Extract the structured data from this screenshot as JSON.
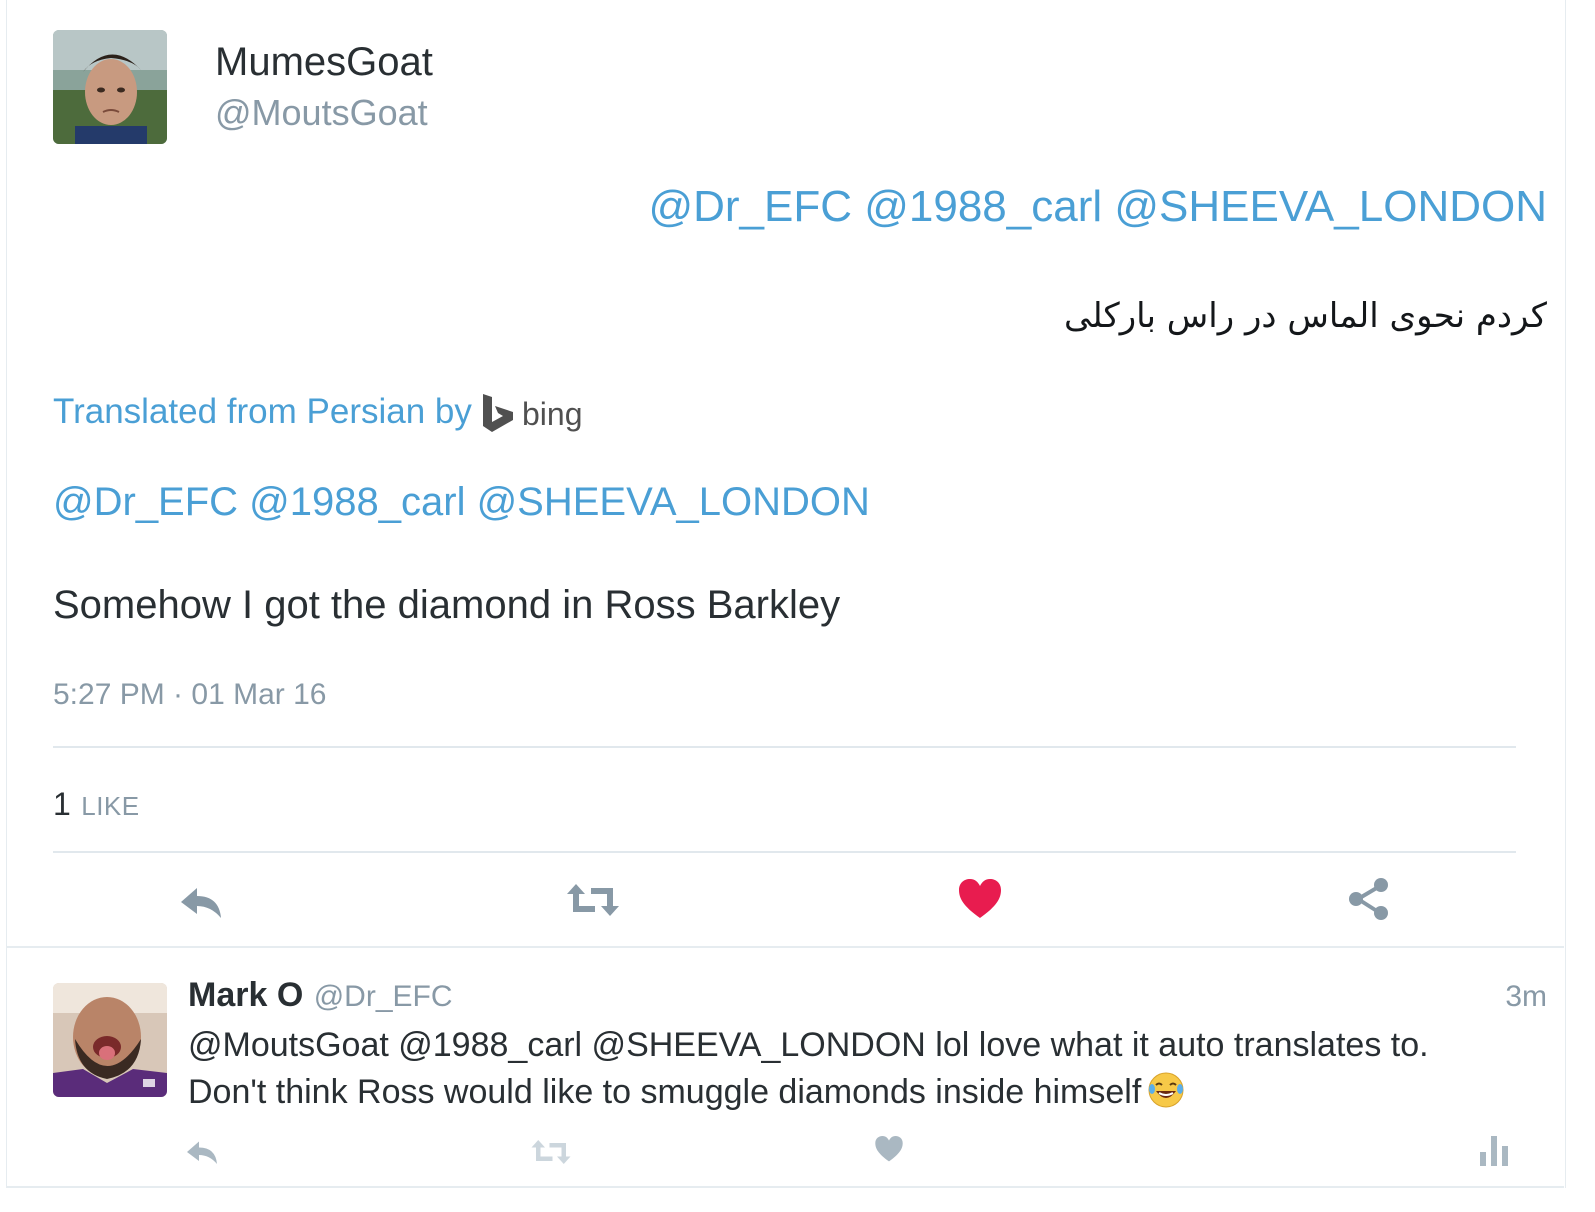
{
  "tweet": {
    "author": {
      "display_name": "MumesGoat",
      "handle": "@MoutsGoat"
    },
    "original_mentions": "@Dr_EFC @1988_carl @SHEEVA_LONDON",
    "original_text": "کردم نحوی الماس در راس بارکلی",
    "translation": {
      "label": "Translated from Persian by",
      "provider": "bing",
      "mentions": "@Dr_EFC @1988_carl @SHEEVA_LONDON",
      "text": "Somehow I got the diamond in Ross Barkley"
    },
    "timestamp": "5:27 PM · 01 Mar 16",
    "likes": {
      "count": "1",
      "label": "LIKE"
    },
    "actions": [
      "reply-icon",
      "retweet-icon",
      "heart-icon",
      "share-icon"
    ],
    "colors": {
      "link": "#4a9fd5",
      "liked": "#e81c4f",
      "muted": "#8899a6"
    }
  },
  "reply": {
    "author": {
      "display_name": "Mark O",
      "handle": "@Dr_EFC"
    },
    "time": "3m",
    "line1": "@MoutsGoat @1988_carl @SHEEVA_LONDON lol love what it auto translates to.",
    "line2": "Don't think Ross would like to smuggle diamonds inside himself",
    "emoji": "face-with-tears-of-joy-icon",
    "actions": [
      "reply-icon",
      "retweet-icon",
      "heart-icon",
      "analytics-icon"
    ]
  }
}
